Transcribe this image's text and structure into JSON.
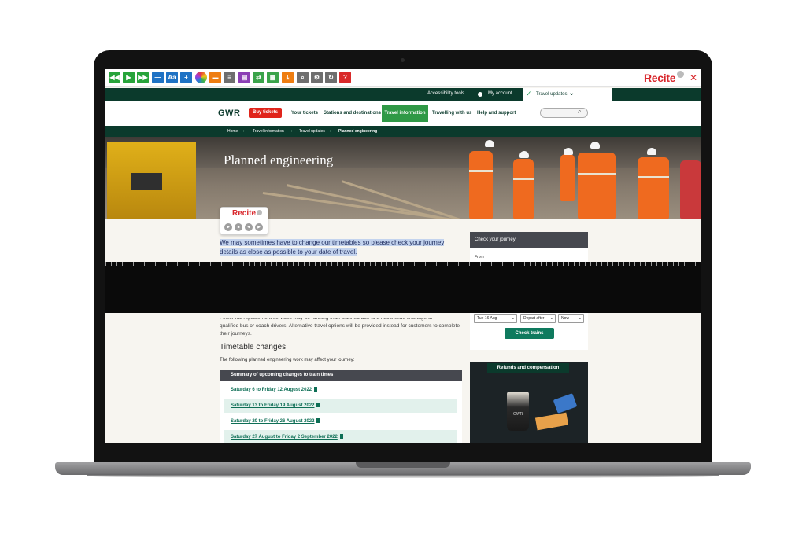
{
  "recite_toolbar": {
    "logo": "Recite",
    "font_button": "Aa",
    "close": "✕"
  },
  "utility_bar": {
    "accessibility_tools": "Accessibility tools",
    "my_account": "My account",
    "travel_updates": "Travel updates"
  },
  "nav": {
    "logo": "GWR",
    "buy_tickets": "Buy tickets",
    "items": [
      "Your tickets",
      "Stations and destinations",
      "Travel information",
      "Travelling with us",
      "Help and support"
    ]
  },
  "breadcrumb": [
    "Home",
    "Travel information",
    "Travel updates",
    "Planned engineering"
  ],
  "hero": {
    "title": "Planned engineering"
  },
  "recite_speech": {
    "logo": "Recite"
  },
  "intro_text": "We may sometimes have to change our timetables so please check your journey details as close as possible to your date of travel.",
  "journey_panel": {
    "heading": "Check your journey",
    "from_label": "From",
    "date": "Tue 16 Aug",
    "depart": "Depart after",
    "time": "Now",
    "check_button": "Check trains"
  },
  "lower": {
    "partial_line": "Fewer rail replacement services may be running than planned due to a nationwide shortage of",
    "paragraph": "qualified bus or coach drivers. Alternative travel options will be provided instead for customers to complete their journeys.",
    "timetable_heading": "Timetable changes",
    "timetable_sub": "The following planned engineering work may affect your journey:",
    "summary_heading": "Summary of upcoming changes to train times",
    "summary_rows": [
      "Saturday 6 to Friday 12 August 2022",
      "Saturday 13 to Friday 19 August 2022",
      "Saturday 20 to Friday 26 August 2022",
      "Saturday 27 August to Friday 2 September 2022"
    ]
  },
  "refund_card": {
    "tag": "Refunds and compensation",
    "cup_label": "GWR"
  },
  "colors": {
    "gwr_green": "#0b3a2c",
    "accent_green": "#2f9946",
    "buy_red": "#e0251b",
    "link_green": "#0d6e55"
  }
}
